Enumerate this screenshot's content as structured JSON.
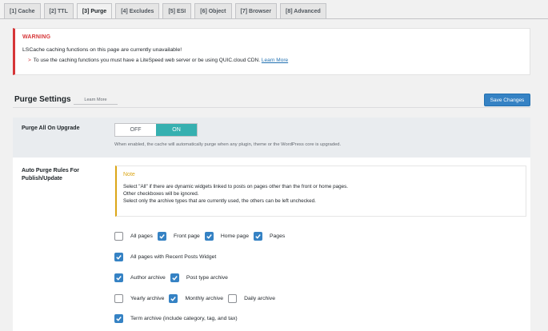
{
  "tabs": [
    {
      "label": "[1] Cache",
      "active": false
    },
    {
      "label": "[2] TTL",
      "active": false
    },
    {
      "label": "[3] Purge",
      "active": true
    },
    {
      "label": "[4] Excludes",
      "active": false
    },
    {
      "label": "[5] ESI",
      "active": false
    },
    {
      "label": "[6] Object",
      "active": false
    },
    {
      "label": "[7] Browser",
      "active": false
    },
    {
      "label": "[8] Advanced",
      "active": false
    }
  ],
  "warning": {
    "title": "WARNING",
    "text": "LSCache caching functions on this page are currently unavailable!",
    "detail": "To use the caching functions you must have a LiteSpeed web server or be using QUIC.cloud CDN.",
    "link": "Learn More"
  },
  "section": {
    "title": "Purge Settings",
    "learn_more": "Learn More",
    "save_label": "Save Changes"
  },
  "purge_upgrade": {
    "label": "Purge All On Upgrade",
    "off_label": "OFF",
    "on_label": "ON",
    "value": "ON",
    "help": "When enabled, the cache will automatically purge when any plugin, theme or the WordPress core is upgraded."
  },
  "auto_purge": {
    "label_line1": "Auto Purge Rules For",
    "label_line2": "Publish/Update",
    "note_title": "Note",
    "note_lines": [
      "Select \"All\" if there are dynamic widgets linked to posts on pages other than the front or home pages.",
      "Other checkboxes will be ignored.",
      "Select only the archive types that are currently used, the others can be left unchecked."
    ],
    "options": [
      {
        "label": "All pages",
        "checked": false
      },
      {
        "label": "Front page",
        "checked": true
      },
      {
        "label": "Home page",
        "checked": true
      },
      {
        "label": "Pages",
        "checked": true
      },
      {
        "label": "All pages with Recent Posts Widget",
        "checked": true
      },
      {
        "label": "Author archive",
        "checked": true
      },
      {
        "label": "Post type archive",
        "checked": true
      },
      {
        "label": "Yearly archive",
        "checked": false
      },
      {
        "label": "Monthly archive",
        "checked": true
      },
      {
        "label": "Daily archive",
        "checked": false
      },
      {
        "label": "Term archive (include category, tag, and tax)",
        "checked": true
      }
    ]
  },
  "colors": {
    "accent": "#3582c4",
    "toggle_on": "#36b0b0",
    "warning": "#d63638",
    "note": "#dba617"
  }
}
